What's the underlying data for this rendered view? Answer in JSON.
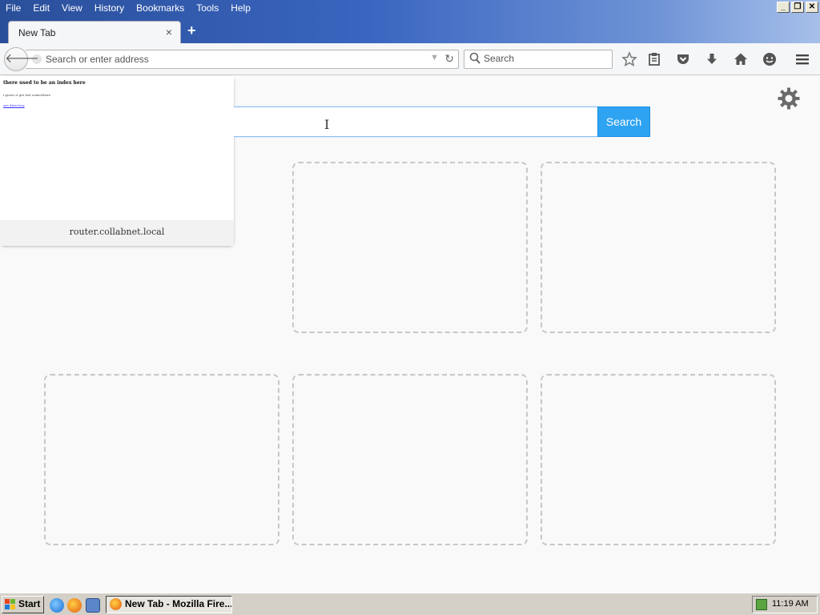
{
  "menu": [
    "File",
    "Edit",
    "View",
    "History",
    "Bookmarks",
    "Tools",
    "Help"
  ],
  "window_controls": {
    "minimize": "_",
    "restore": "❐",
    "close": "✕"
  },
  "tab": {
    "title": "New Tab",
    "close": "×",
    "new_tab": "+"
  },
  "urlbar": {
    "placeholder": "Search or enter address"
  },
  "searchbar": {
    "placeholder": "Search"
  },
  "newtab": {
    "search_button": "Search",
    "tiles": [
      {
        "label": "router.collabnet.local",
        "thumbnail_heading": "there used to be an index here",
        "thumbnail_body": "i guess it got lost somewhere",
        "thumbnail_link": "see directory"
      }
    ]
  },
  "taskbar": {
    "start": "Start",
    "task_label": "New Tab - Mozilla Fire...",
    "clock": "11:19 AM"
  },
  "colors": {
    "accent": "#2ea3f2",
    "title_gradient_start": "#2a4f9a"
  }
}
